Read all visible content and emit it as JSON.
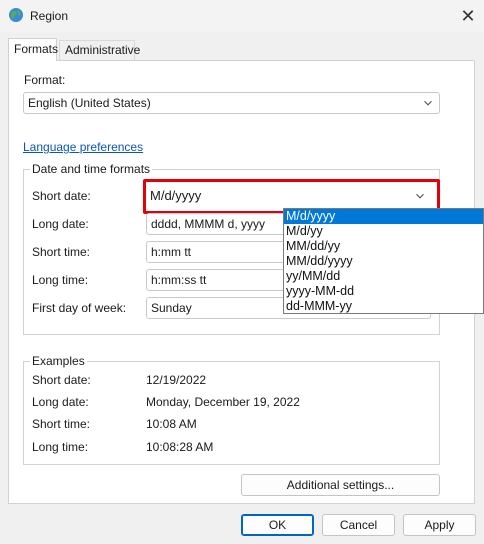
{
  "window": {
    "title": "Region",
    "close_glyph": "✕"
  },
  "tabs": [
    {
      "label": "Formats"
    },
    {
      "label": "Administrative"
    }
  ],
  "format": {
    "label": "Format:",
    "value": "English (United States)"
  },
  "language_link": "Language preferences",
  "date_time": {
    "title": "Date and time formats",
    "short_date": {
      "label": "Short date:",
      "value": "M/d/yyyy"
    },
    "long_date": {
      "label": "Long date:",
      "value": "dddd, MMMM d, yyyy"
    },
    "short_time": {
      "label": "Short time:",
      "value": "h:mm tt"
    },
    "long_time": {
      "label": "Long time:",
      "value": "h:mm:ss tt"
    },
    "first_day": {
      "label": "First day of week:",
      "value": "Sunday"
    }
  },
  "short_date_options": [
    "M/d/yyyy",
    "M/d/yy",
    "MM/dd/yy",
    "MM/dd/yyyy",
    "yy/MM/dd",
    "yyyy-MM-dd",
    "dd-MMM-yy"
  ],
  "examples": {
    "title": "Examples",
    "short_date": {
      "label": "Short date:",
      "value": "12/19/2022"
    },
    "long_date": {
      "label": "Long date:",
      "value": "Monday, December 19, 2022"
    },
    "short_time": {
      "label": "Short time:",
      "value": "10:08 AM"
    },
    "long_time": {
      "label": "Long time:",
      "value": "10:08:28 AM"
    }
  },
  "buttons": {
    "additional": "Additional settings...",
    "ok": "OK",
    "cancel": "Cancel",
    "apply": "Apply"
  },
  "colors": {
    "accent": "#0078d7",
    "highlight_border": "#e1000b",
    "link": "#0b57b6"
  }
}
